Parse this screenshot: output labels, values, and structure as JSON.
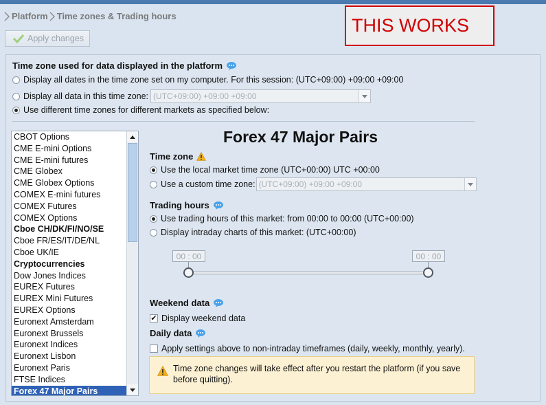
{
  "breadcrumb": {
    "root": "Platform",
    "current": "Time zones & Trading hours"
  },
  "toolbar": {
    "apply_label": "Apply changes"
  },
  "overlay_label": "THIS WORKS",
  "timezone_section": {
    "title": "Time zone used for data displayed in the platform",
    "option_computer": "Display all dates in the time zone set on my computer. For this session:  (UTC+09:00) +09:00 +09:00",
    "option_this_zone": "Display all data in this time zone:",
    "this_zone_value": "(UTC+09:00) +09:00 +09:00",
    "option_per_market": "Use different time zones for different markets as specified below:",
    "selected": "per_market"
  },
  "markets": {
    "items": [
      {
        "label": "CBOT Options",
        "bold": false
      },
      {
        "label": "CME E-mini Options",
        "bold": false
      },
      {
        "label": "CME E-mini futures",
        "bold": false
      },
      {
        "label": "CME Globex",
        "bold": false
      },
      {
        "label": "CME Globex Options",
        "bold": false
      },
      {
        "label": "COMEX E-mini futures",
        "bold": false
      },
      {
        "label": "COMEX Futures",
        "bold": false
      },
      {
        "label": "COMEX Options",
        "bold": false
      },
      {
        "label": "Cboe CH/DK/FI/NO/SE",
        "bold": true
      },
      {
        "label": "Cboe FR/ES/IT/DE/NL",
        "bold": false
      },
      {
        "label": "Cboe UK/IE",
        "bold": false
      },
      {
        "label": "Cryptocurrencies",
        "bold": true
      },
      {
        "label": "Dow Jones Indices",
        "bold": false
      },
      {
        "label": "EUREX Futures",
        "bold": false
      },
      {
        "label": "EUREX Mini Futures",
        "bold": false
      },
      {
        "label": "EUREX Options",
        "bold": false
      },
      {
        "label": "Euronext Amsterdam",
        "bold": false
      },
      {
        "label": "Euronext Brussels",
        "bold": false
      },
      {
        "label": "Euronext Indices",
        "bold": false
      },
      {
        "label": "Euronext Lisbon",
        "bold": false
      },
      {
        "label": "Euronext Paris",
        "bold": false
      },
      {
        "label": "FTSE Indices",
        "bold": false
      },
      {
        "label": "Forex 47 Major Pairs",
        "bold": false
      }
    ],
    "selected_index": 22
  },
  "detail": {
    "title": "Forex 47 Major Pairs",
    "timezone_heading": "Time zone",
    "tz_local": "Use the local market time zone (UTC+00:00) UTC +00:00",
    "tz_custom": "Use a custom time zone:",
    "tz_custom_value": "(UTC+09:00) +09:00 +09:00",
    "trading_heading": "Trading hours",
    "th_market": "Use trading hours of this market: from 00:00 to 00:00 (UTC+00:00)",
    "th_intraday": "Display intraday charts of this market: (UTC+00:00)",
    "slider_start": "00 : 00",
    "slider_end": "00 : 00",
    "weekend_heading": "Weekend data",
    "weekend_check": "Display weekend data",
    "weekend_checked": true,
    "daily_heading": "Daily data",
    "daily_check": "Apply settings above to non-intraday timeframes (daily, weekly, monthly, yearly).",
    "daily_checked": false,
    "notice": "Time zone changes will take effect after you restart the platform (if you save before quitting)."
  }
}
